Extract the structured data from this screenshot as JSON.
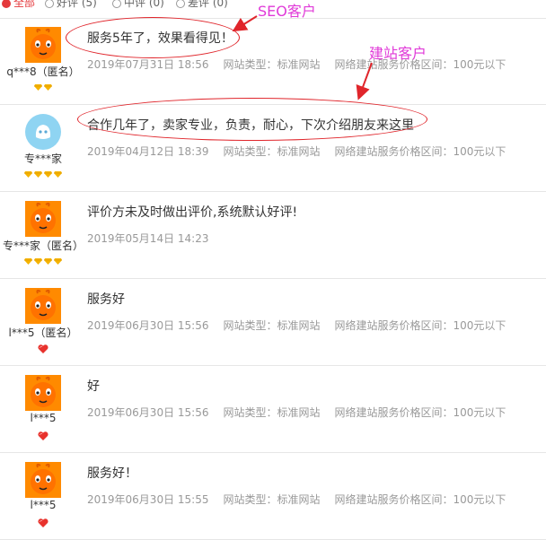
{
  "tabs": [
    {
      "label": "全部",
      "active": true
    },
    {
      "label": "好评 (5)",
      "active": false
    },
    {
      "label": "中评 (0)",
      "active": false
    },
    {
      "label": "差评 (0)",
      "active": false
    }
  ],
  "annotations": {
    "seo_label": "SEO客户",
    "site_label": "建站客户",
    "color_label": "#e03ad8",
    "color_mark": "#e0252b"
  },
  "reviews": [
    {
      "user": "q***8（匿名）",
      "avatar": "orange-avatar",
      "badge": "diamond",
      "badge_count": 2,
      "content": "服务5年了，效果看得见！",
      "date": "2019年07月31日 18:56",
      "site_type": "网站类型：标准网站",
      "price": "网络建站服务价格区间：100元以下"
    },
    {
      "user": "专***家",
      "avatar": "blue-avatar",
      "badge": "diamond",
      "badge_count": 4,
      "content": "合作几年了，卖家专业，负责，耐心，下次介绍朋友来这里",
      "date": "2019年04月12日 18:39",
      "site_type": "网站类型：标准网站",
      "price": "网络建站服务价格区间：100元以下"
    },
    {
      "user": "专***家（匿名）",
      "avatar": "orange-avatar",
      "badge": "diamond",
      "badge_count": 4,
      "content": "评价方未及时做出评价,系统默认好评!",
      "date": "2019年05月14日 14:23",
      "site_type": "",
      "price": ""
    },
    {
      "user": "l***5（匿名）",
      "avatar": "orange-avatar",
      "badge": "heart",
      "badge_count": 1,
      "content": "服务好",
      "date": "2019年06月30日 15:56",
      "site_type": "网站类型：标准网站",
      "price": "网络建站服务价格区间：100元以下"
    },
    {
      "user": "l***5",
      "avatar": "orange-avatar",
      "badge": "heart",
      "badge_count": 1,
      "content": "好",
      "date": "2019年06月30日 15:56",
      "site_type": "网站类型：标准网站",
      "price": "网络建站服务价格区间：100元以下"
    },
    {
      "user": "l***5",
      "avatar": "orange-avatar",
      "badge": "heart",
      "badge_count": 1,
      "content": "服务好！",
      "date": "2019年06月30日 15:55",
      "site_type": "网站类型：标准网站",
      "price": "网络建站服务价格区间：100元以下"
    }
  ]
}
